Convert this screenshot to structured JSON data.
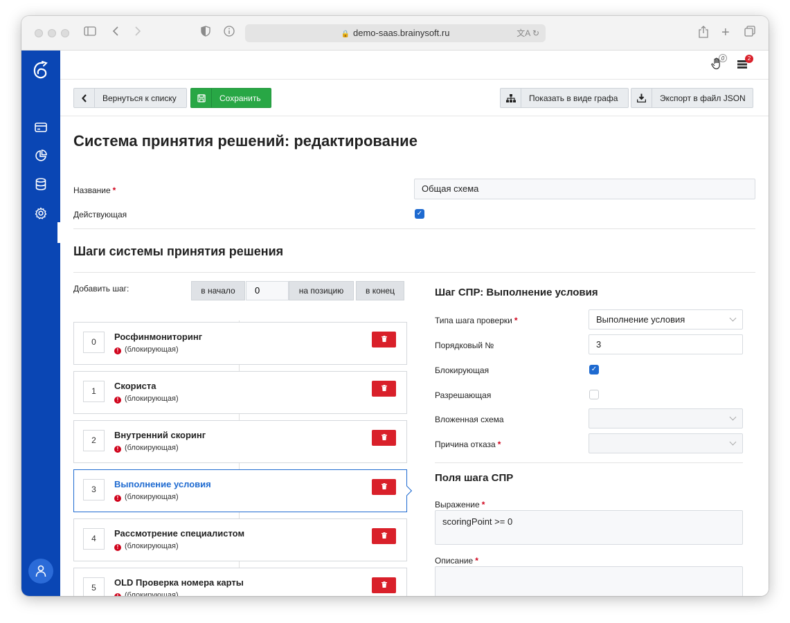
{
  "browser": {
    "url": "demo-saas.brainysoft.ru"
  },
  "header": {
    "hand_badge": "0",
    "list_badge": "2"
  },
  "toolbar": {
    "back_label": "Вернуться к списку",
    "save_label": "Сохранить",
    "graph_label": "Показать в виде графа",
    "export_label": "Экспорт в файл JSON"
  },
  "page": {
    "title": "Система принятия решений: редактирование"
  },
  "form": {
    "name_label": "Название",
    "name_value": "Общая схема",
    "active_label": "Действующая",
    "required_mark": "*"
  },
  "steps_section": {
    "title": "Шаги системы принятия решения",
    "add_label": "Добавить шаг:",
    "btn_start": "в начало",
    "position_value": "0",
    "btn_position": "на позицию",
    "btn_end": "в конец"
  },
  "steps": [
    {
      "num": "0",
      "name": "Росфинмониторинг",
      "sub": "(блокирующая)"
    },
    {
      "num": "1",
      "name": "Скориста",
      "sub": "(блокирующая)"
    },
    {
      "num": "2",
      "name": "Внутренний скоринг",
      "sub": "(блокирующая)"
    },
    {
      "num": "3",
      "name": "Выполнение условия",
      "sub": "(блокирующая)"
    },
    {
      "num": "4",
      "name": "Рассмотрение специалистом",
      "sub": "(блокирующая)"
    },
    {
      "num": "5",
      "name": "OLD Проверка номера карты",
      "sub": "(блокирующая)"
    }
  ],
  "step_detail": {
    "title": "Шаг СПР: Выполнение условия",
    "type_label": "Типа шага проверки",
    "type_value": "Выполнение условия",
    "order_label": "Порядковый №",
    "order_value": "3",
    "blocking_label": "Блокирующая",
    "allowing_label": "Разрешающая",
    "nested_label": "Вложенная схема",
    "reason_label": "Причина отказа"
  },
  "fields_section": {
    "title": "Поля шага СПР",
    "expr_label": "Выражение",
    "expr_value": "scoringPoint >= 0",
    "desc_label": "Описание",
    "desc_value": ""
  },
  "colors": {
    "sidebar": "#0a46b4",
    "accent": "#1e6ad0",
    "save": "#28a745",
    "delete": "#d9202a"
  }
}
